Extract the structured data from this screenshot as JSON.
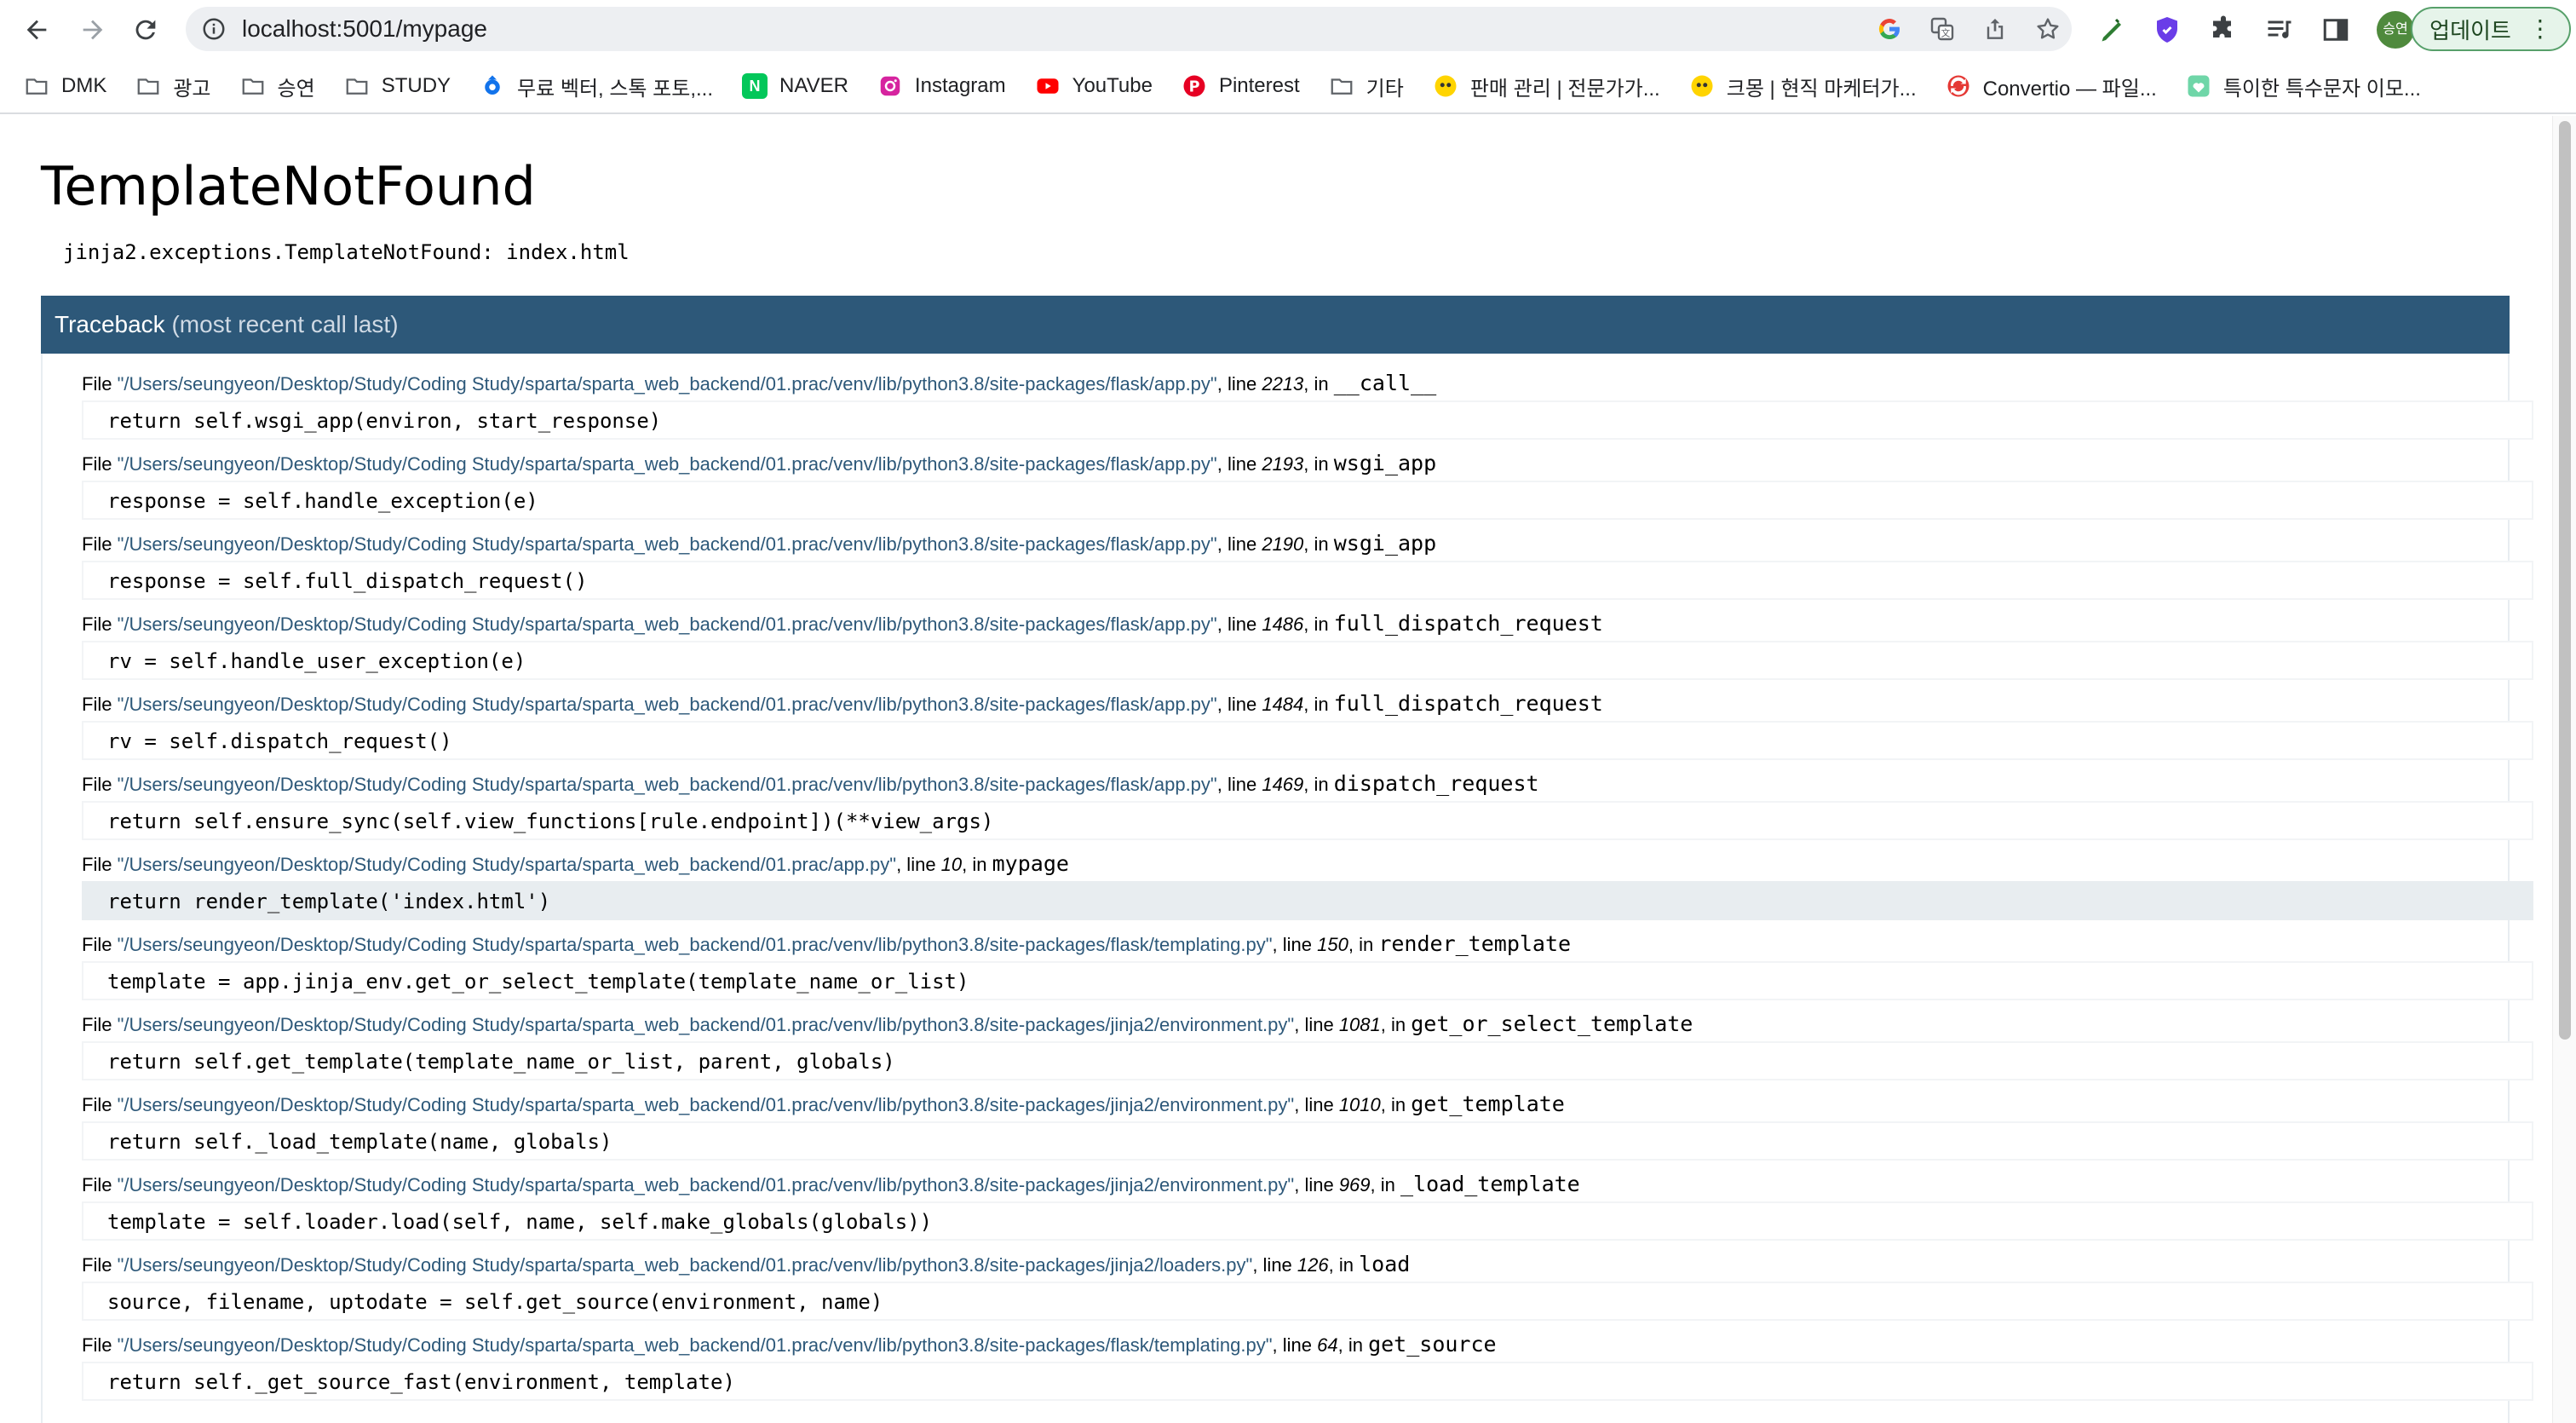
{
  "browser": {
    "url": "localhost:5001/mypage",
    "update_label": "업데이트",
    "avatar_label": "승연"
  },
  "bookmarks": [
    {
      "label": "DMK",
      "icon": "folder-icon"
    },
    {
      "label": "광고",
      "icon": "folder-icon"
    },
    {
      "label": "승연",
      "icon": "folder-icon"
    },
    {
      "label": "STUDY",
      "icon": "folder-icon"
    },
    {
      "label": "무료 벡터, 스톡 포토,...",
      "icon": "freepik-icon"
    },
    {
      "label": "NAVER",
      "icon": "naver-icon"
    },
    {
      "label": "Instagram",
      "icon": "instagram-icon"
    },
    {
      "label": "YouTube",
      "icon": "youtube-icon"
    },
    {
      "label": "Pinterest",
      "icon": "pinterest-icon"
    },
    {
      "label": "기타",
      "icon": "folder-icon"
    },
    {
      "label": "판매 관리 | 전문가가...",
      "icon": "kmong-icon"
    },
    {
      "label": "크몽 | 현직 마케터가...",
      "icon": "kmong-icon"
    },
    {
      "label": "Convertio — 파일...",
      "icon": "convertio-icon"
    },
    {
      "label": "특이한 특수문자 이모...",
      "icon": "heart-icon"
    }
  ],
  "error": {
    "title": "TemplateNotFound",
    "message": "jinja2.exceptions.TemplateNotFound: index.html",
    "traceback_label": "Traceback",
    "traceback_sub": "(most recent call last)"
  },
  "traceback": [
    {
      "file_prefix": "File ",
      "path": "\"/Users/seungyeon/Desktop/Study/Coding Study/sparta/sparta_web_backend/01.prac/venv/lib/python3.8/site-packages/flask/app.py\"",
      "line_label": ", line ",
      "line": "2213",
      "in_label": ", in ",
      "func": "__call__",
      "code": "return self.wsgi_app(environ, start_response)",
      "active": false
    },
    {
      "file_prefix": "File ",
      "path": "\"/Users/seungyeon/Desktop/Study/Coding Study/sparta/sparta_web_backend/01.prac/venv/lib/python3.8/site-packages/flask/app.py\"",
      "line_label": ", line ",
      "line": "2193",
      "in_label": ", in ",
      "func": "wsgi_app",
      "code": "response = self.handle_exception(e)",
      "active": false
    },
    {
      "file_prefix": "File ",
      "path": "\"/Users/seungyeon/Desktop/Study/Coding Study/sparta/sparta_web_backend/01.prac/venv/lib/python3.8/site-packages/flask/app.py\"",
      "line_label": ", line ",
      "line": "2190",
      "in_label": ", in ",
      "func": "wsgi_app",
      "code": "response = self.full_dispatch_request()",
      "active": false
    },
    {
      "file_prefix": "File ",
      "path": "\"/Users/seungyeon/Desktop/Study/Coding Study/sparta/sparta_web_backend/01.prac/venv/lib/python3.8/site-packages/flask/app.py\"",
      "line_label": ", line ",
      "line": "1486",
      "in_label": ", in ",
      "func": "full_dispatch_request",
      "code": "rv = self.handle_user_exception(e)",
      "active": false
    },
    {
      "file_prefix": "File ",
      "path": "\"/Users/seungyeon/Desktop/Study/Coding Study/sparta/sparta_web_backend/01.prac/venv/lib/python3.8/site-packages/flask/app.py\"",
      "line_label": ", line ",
      "line": "1484",
      "in_label": ", in ",
      "func": "full_dispatch_request",
      "code": "rv = self.dispatch_request()",
      "active": false
    },
    {
      "file_prefix": "File ",
      "path": "\"/Users/seungyeon/Desktop/Study/Coding Study/sparta/sparta_web_backend/01.prac/venv/lib/python3.8/site-packages/flask/app.py\"",
      "line_label": ", line ",
      "line": "1469",
      "in_label": ", in ",
      "func": "dispatch_request",
      "code": "return self.ensure_sync(self.view_functions[rule.endpoint])(**view_args)",
      "active": false
    },
    {
      "file_prefix": "File ",
      "path": "\"/Users/seungyeon/Desktop/Study/Coding Study/sparta/sparta_web_backend/01.prac/app.py\"",
      "line_label": ", line ",
      "line": "10",
      "in_label": ", in ",
      "func": "mypage",
      "code": "return render_template('index.html')",
      "active": true
    },
    {
      "file_prefix": "File ",
      "path": "\"/Users/seungyeon/Desktop/Study/Coding Study/sparta/sparta_web_backend/01.prac/venv/lib/python3.8/site-packages/flask/templating.py\"",
      "line_label": ", line ",
      "line": "150",
      "in_label": ", in ",
      "func": "render_template",
      "code": "template = app.jinja_env.get_or_select_template(template_name_or_list)",
      "active": false
    },
    {
      "file_prefix": "File ",
      "path": "\"/Users/seungyeon/Desktop/Study/Coding Study/sparta/sparta_web_backend/01.prac/venv/lib/python3.8/site-packages/jinja2/environment.py\"",
      "line_label": ", line ",
      "line": "1081",
      "in_label": ", in ",
      "func": "get_or_select_template",
      "code": "return self.get_template(template_name_or_list, parent, globals)",
      "active": false
    },
    {
      "file_prefix": "File ",
      "path": "\"/Users/seungyeon/Desktop/Study/Coding Study/sparta/sparta_web_backend/01.prac/venv/lib/python3.8/site-packages/jinja2/environment.py\"",
      "line_label": ", line ",
      "line": "1010",
      "in_label": ", in ",
      "func": "get_template",
      "code": "return self._load_template(name, globals)",
      "active": false
    },
    {
      "file_prefix": "File ",
      "path": "\"/Users/seungyeon/Desktop/Study/Coding Study/sparta/sparta_web_backend/01.prac/venv/lib/python3.8/site-packages/jinja2/environment.py\"",
      "line_label": ", line ",
      "line": "969",
      "in_label": ", in ",
      "func": "_load_template",
      "code": "template = self.loader.load(self, name, self.make_globals(globals))",
      "active": false
    },
    {
      "file_prefix": "File ",
      "path": "\"/Users/seungyeon/Desktop/Study/Coding Study/sparta/sparta_web_backend/01.prac/venv/lib/python3.8/site-packages/jinja2/loaders.py\"",
      "line_label": ", line ",
      "line": "126",
      "in_label": ", in ",
      "func": "load",
      "code": "source, filename, uptodate = self.get_source(environment, name)",
      "active": false
    },
    {
      "file_prefix": "File ",
      "path": "\"/Users/seungyeon/Desktop/Study/Coding Study/sparta/sparta_web_backend/01.prac/venv/lib/python3.8/site-packages/flask/templating.py\"",
      "line_label": ", line ",
      "line": "64",
      "in_label": ", in ",
      "func": "get_source",
      "code": "return self._get_source_fast(environment, template)",
      "active": false
    }
  ]
}
